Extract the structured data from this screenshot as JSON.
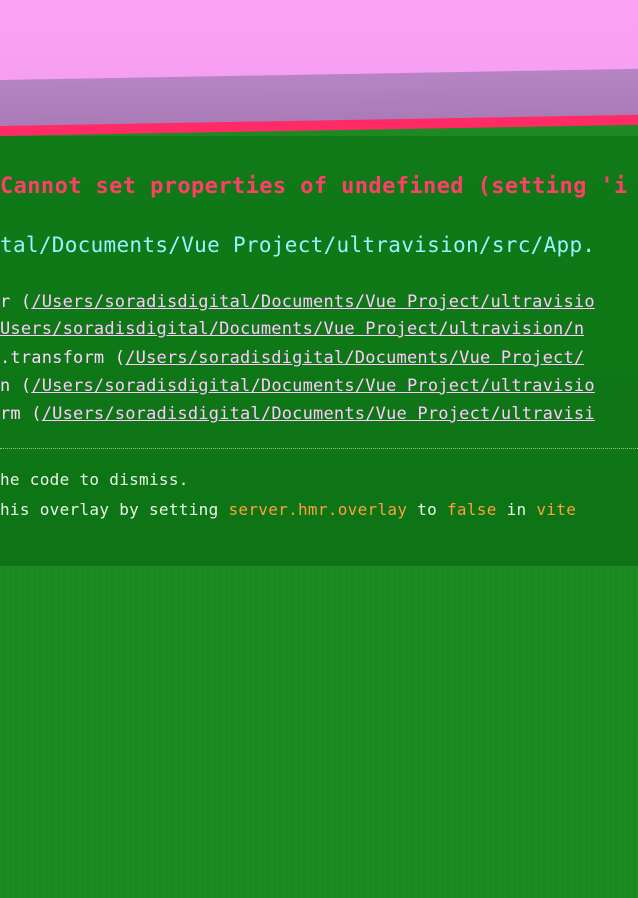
{
  "overlay": {
    "message": "Cannot set properties of undefined (setting 'i",
    "file": "tal/Documents/Vue Project/ultravision/src/App.",
    "stack": [
      {
        "prefix": "r (",
        "path": "/Users/soradisdigital/Documents/Vue Project/ultravisio"
      },
      {
        "prefix": "",
        "path": "Users/soradisdigital/Documents/Vue Project/ultravision/n"
      },
      {
        "prefix": ".transform (",
        "path": "/Users/soradisdigital/Documents/Vue Project/"
      },
      {
        "prefix": "n (",
        "path": "/Users/soradisdigital/Documents/Vue Project/ultravisio"
      },
      {
        "prefix": "rm (",
        "path": "/Users/soradisdigital/Documents/Vue Project/ultravisi"
      }
    ],
    "tip_line1": "he code to dismiss.",
    "tip_line2_pre": "his overlay by setting ",
    "tip_code1": "server.hmr.overlay",
    "tip_mid": " to ",
    "tip_code2": "false",
    "tip_post": " in ",
    "tip_code3": "vite"
  },
  "colors": {
    "error_message": "#ff3f67",
    "file_path": "#9ef0ff",
    "stack_text": "#ffd6ff",
    "code_highlight": "#ff9f3a",
    "overlay_border": "#ff2a66"
  }
}
